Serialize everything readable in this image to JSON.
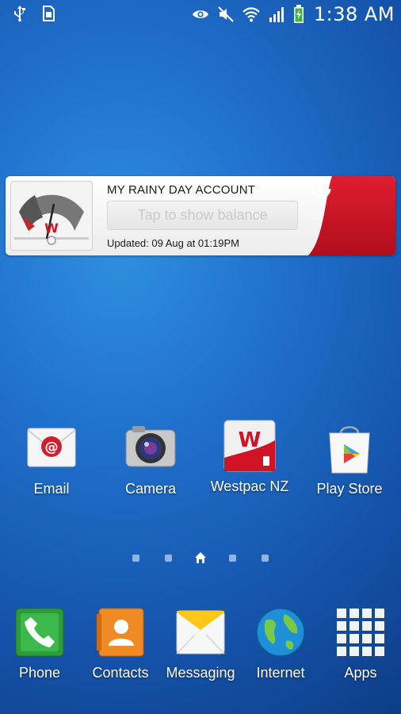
{
  "status_bar": {
    "time": "1:38 AM",
    "left_icons": [
      "usb-icon",
      "sd-card-icon"
    ],
    "right_icons": [
      "eye-icon",
      "mute-icon",
      "wifi-icon",
      "signal-icon",
      "battery-icon"
    ]
  },
  "widget": {
    "title": "MY RAINY DAY ACCOUNT",
    "tap_label": "Tap to show balance",
    "updated": "Updated: 09 Aug at 01:19PM",
    "brand_letter": "W",
    "accent_color": "#d01426"
  },
  "apps": [
    {
      "label": "Email",
      "icon": "email-icon"
    },
    {
      "label": "Camera",
      "icon": "camera-icon"
    },
    {
      "label": "Westpac NZ",
      "icon": "westpac-icon"
    },
    {
      "label": "Play Store",
      "icon": "play-store-icon"
    }
  ],
  "pager": {
    "pages": 5,
    "current": 3
  },
  "dock": [
    {
      "label": "Phone",
      "icon": "phone-icon"
    },
    {
      "label": "Contacts",
      "icon": "contacts-icon"
    },
    {
      "label": "Messaging",
      "icon": "messaging-icon"
    },
    {
      "label": "Internet",
      "icon": "globe-icon"
    },
    {
      "label": "Apps",
      "icon": "apps-grid-icon"
    }
  ]
}
